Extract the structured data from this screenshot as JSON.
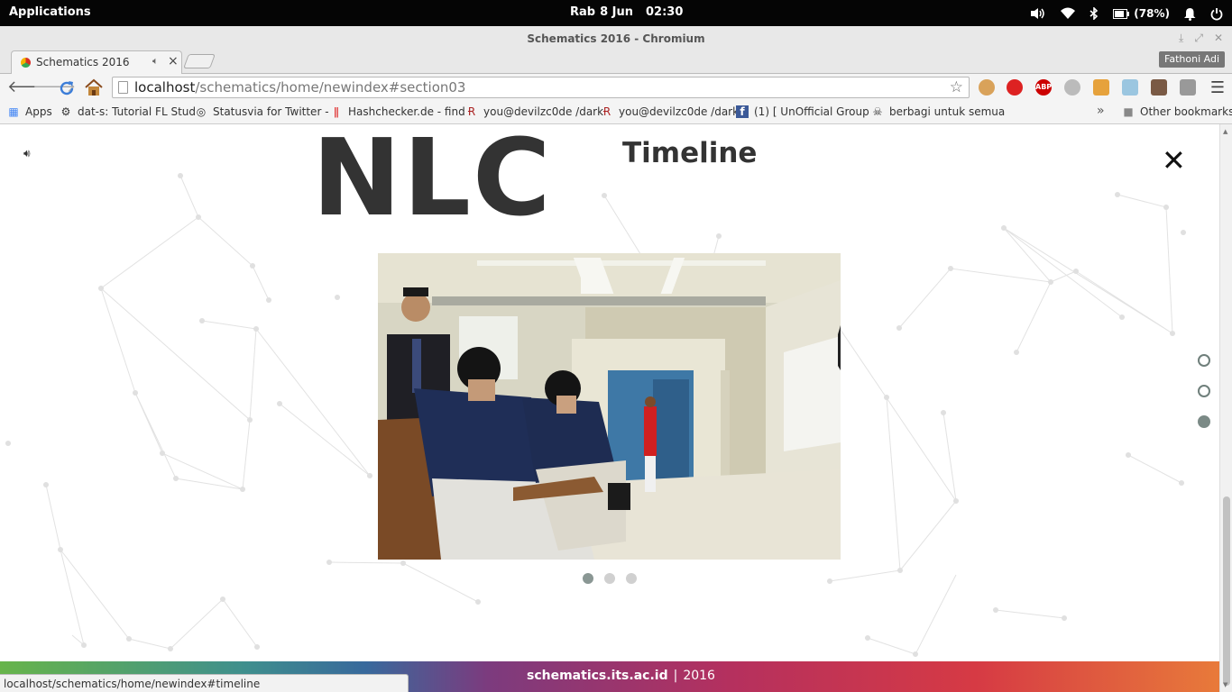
{
  "system_bar": {
    "applications_label": "Applications",
    "day": "Rab",
    "date": "8 Jun",
    "time": "02:30",
    "battery_text": "(78%)"
  },
  "window": {
    "title": "Schematics 2016 - Chromium",
    "user": "Fathoni Adi"
  },
  "tab": {
    "label": "Schematics 2016"
  },
  "address_bar": {
    "host": "localhost",
    "path": "/schematics/home/newindex#section03"
  },
  "bookmarks": {
    "items": [
      {
        "label": "Apps",
        "icon": "apps-grid-icon"
      },
      {
        "label": "dat-s: Tutorial FL Stud",
        "icon": "dat-s-icon"
      },
      {
        "label": "Statusvia for Twitter -",
        "icon": "statusvia-icon"
      },
      {
        "label": "Hashchecker.de - find",
        "icon": "hashchecker-icon"
      },
      {
        "label": "you@devilzc0de /dark",
        "icon": "devilzc0de-icon"
      },
      {
        "label": "you@devilzc0de /dark",
        "icon": "devilzc0de-icon"
      },
      {
        "label": "(1) [ UnOfficial Group",
        "icon": "facebook-icon"
      },
      {
        "label": "berbagi untuk semua",
        "icon": "pirate-icon"
      }
    ],
    "more": "»",
    "other": "Other bookmarks"
  },
  "page": {
    "heading": "NLC",
    "section": "Timeline",
    "close": "✕",
    "carousel": {
      "count": 3,
      "active": 0
    },
    "side_nav": {
      "count": 3,
      "active": 2
    }
  },
  "footer": {
    "site": "schematics.its.ac.id",
    "separator": "|",
    "year": "2016"
  },
  "status_url": "localhost/schematics/home/newindex#timeline",
  "colors": {
    "topbar_bg": "#050505",
    "heading": "#333333",
    "dot_active": "#8a9794"
  }
}
